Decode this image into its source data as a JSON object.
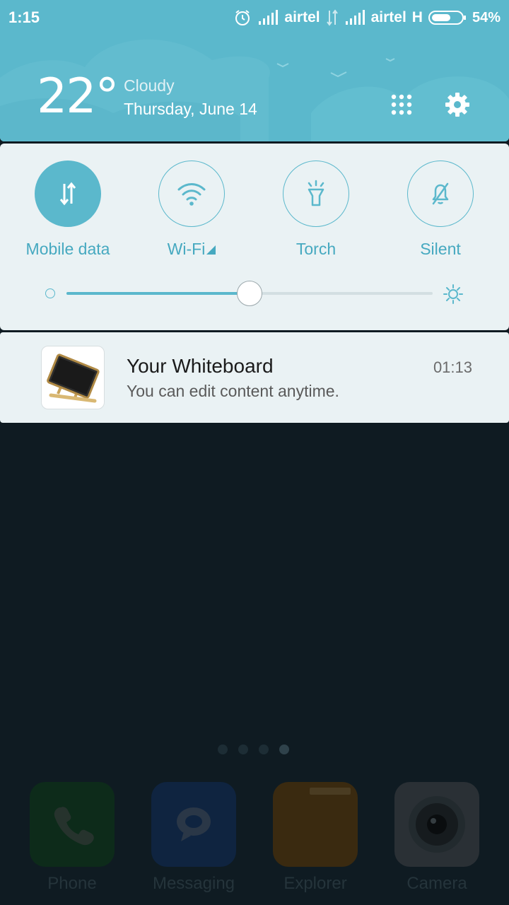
{
  "status_bar": {
    "time": "1:15",
    "carrier_1": "airtel",
    "carrier_2": "airtel",
    "network_type_2": "H",
    "battery_percent": "54%",
    "icons": [
      "alarm-icon",
      "signal-icon",
      "data-arrows-icon",
      "signal-icon",
      "battery-icon"
    ]
  },
  "weather": {
    "temperature": "22°",
    "condition": "Cloudy",
    "date": "Thursday, June 14"
  },
  "header_actions": {
    "icons": [
      "apps-grid-icon",
      "settings-gear-icon"
    ]
  },
  "quick_toggles": [
    {
      "label": "Mobile data",
      "icon": "mobile-data-icon",
      "active": true
    },
    {
      "label": "Wi-Fi",
      "icon": "wifi-icon",
      "active": false
    },
    {
      "label": "Torch",
      "icon": "torch-icon",
      "active": false
    },
    {
      "label": "Silent",
      "icon": "silent-bell-icon",
      "active": false
    }
  ],
  "brightness": {
    "level": 0.5
  },
  "notification": {
    "app_icon": "whiteboard-icon",
    "title": "Your Whiteboard",
    "text": "You can edit content anytime.",
    "time": "01:13"
  },
  "home_screen": {
    "page_count": 4,
    "active_page": 4,
    "dock": [
      {
        "label": "Phone",
        "icon": "phone-icon",
        "color": "#0d2b1a"
      },
      {
        "label": "Messaging",
        "icon": "message-icon",
        "color": "#0f2440"
      },
      {
        "label": "Explorer",
        "icon": "folder-icon",
        "color": "#3a2a10"
      },
      {
        "label": "Camera",
        "icon": "camera-icon",
        "color": "#2a3035"
      }
    ]
  },
  "colors": {
    "accent": "#5bb8cc",
    "panel_bg": "#eaf2f4",
    "dim_bg": "#0f1b22"
  }
}
